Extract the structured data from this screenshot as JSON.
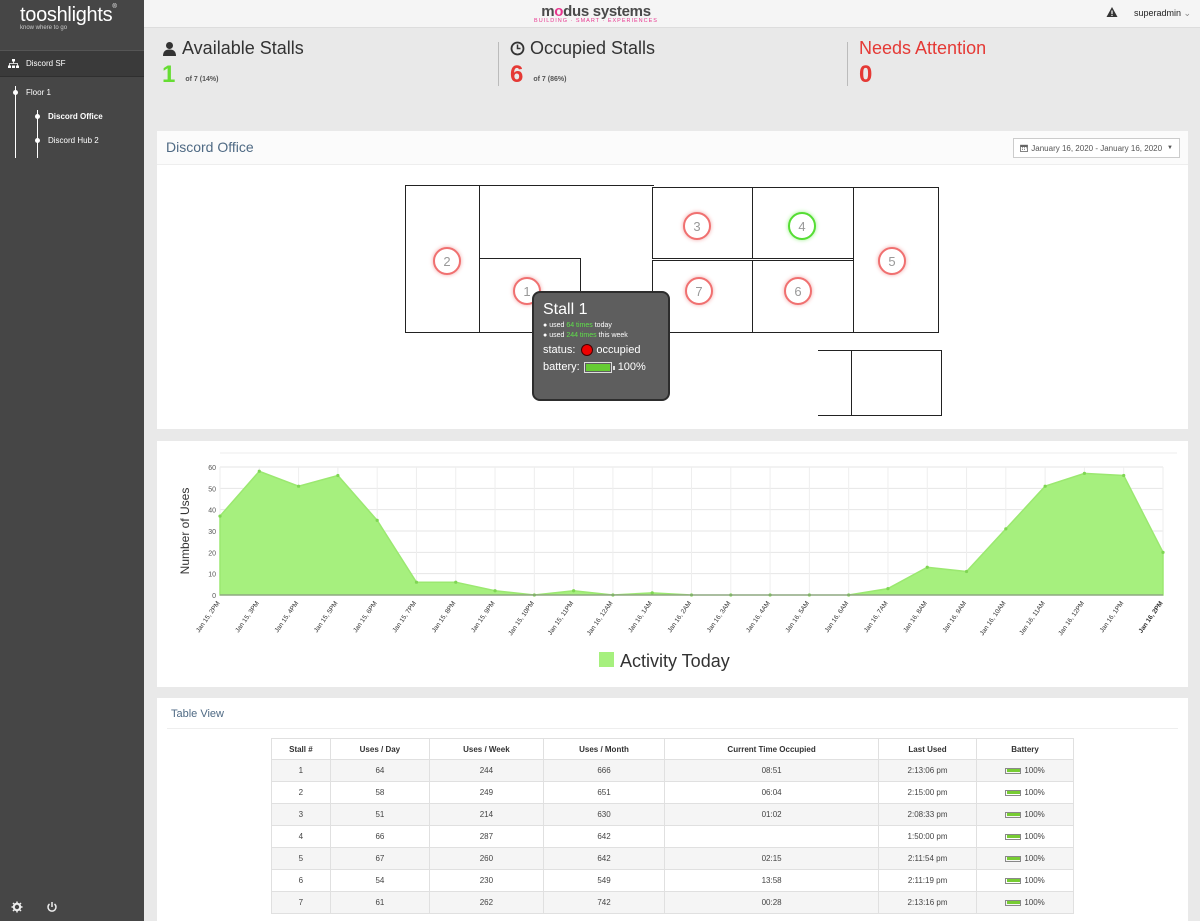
{
  "sidebar": {
    "brand": "tooshlights",
    "tagline": "know where to go",
    "root_item": "Discord SF",
    "tree": {
      "floor": "Floor 1",
      "rooms": [
        "Discord Office",
        "Discord Hub 2"
      ]
    },
    "icons": [
      "sitemap-icon",
      "gear-icon",
      "power-icon"
    ]
  },
  "topbar": {
    "logo_main_a": "m",
    "logo_main_o": "o",
    "logo_main_b": "dus systems",
    "logo_sub": "BUILDING · SMART · EXPERIENCES",
    "user": "superadmin",
    "user_caret": "⌄"
  },
  "stats": {
    "available": {
      "title": "Available Stalls",
      "value": "1",
      "detail": "of 7 (14%)",
      "color": "#66dd33"
    },
    "occupied": {
      "title": "Occupied Stalls",
      "value": "6",
      "detail": "of 7 (86%)",
      "color": "#e53935"
    },
    "attention": {
      "title": "Needs Attention",
      "value": "0",
      "color": "#e53935"
    }
  },
  "office": {
    "title": "Discord Office",
    "date_range": "January 16, 2020 - January 16, 2020",
    "stalls": [
      {
        "id": "2",
        "status": "occupied"
      },
      {
        "id": "1",
        "status": "occupied"
      },
      {
        "id": "3",
        "status": "occupied"
      },
      {
        "id": "4",
        "status": "free"
      },
      {
        "id": "7",
        "status": "occupied"
      },
      {
        "id": "6",
        "status": "occupied"
      },
      {
        "id": "5",
        "status": "occupied"
      }
    ],
    "tooltip": {
      "title": "Stall 1",
      "line1_pre": "used ",
      "line1_hl": "64 times",
      "line1_post": " today",
      "line2_pre": "used ",
      "line2_hl": "244 times",
      "line2_post": " this week",
      "status_label": "status:",
      "status_value": "occupied",
      "battery_label": "battery:",
      "battery_value": "100%",
      "battery_level": 1.0
    }
  },
  "chart_data": {
    "type": "area",
    "ylabel": "Number of Uses",
    "ylim": [
      0,
      60
    ],
    "yticks": [
      0,
      10,
      20,
      30,
      40,
      50,
      60
    ],
    "legend": "Activity Today",
    "legend_position": "bottom",
    "color": "#a6f07e",
    "grid": true,
    "categories": [
      "Jan 15, 2PM",
      "Jan 15, 3PM",
      "Jan 15, 4PM",
      "Jan 15, 5PM",
      "Jan 15, 6PM",
      "Jan 15, 7PM",
      "Jan 15, 8PM",
      "Jan 15, 9PM",
      "Jan 15, 10PM",
      "Jan 15, 11PM",
      "Jan 16, 12AM",
      "Jan 16, 1AM",
      "Jan 16, 2AM",
      "Jan 16, 3AM",
      "Jan 16, 4AM",
      "Jan 16, 5AM",
      "Jan 16, 6AM",
      "Jan 16, 7AM",
      "Jan 16, 8AM",
      "Jan 16, 9AM",
      "Jan 16, 10AM",
      "Jan 16, 11AM",
      "Jan 16, 12PM",
      "Jan 16, 1PM",
      "Jan 16, 2PM"
    ],
    "values": [
      37,
      58,
      51,
      56,
      35,
      6,
      6,
      2,
      0,
      2,
      0,
      1,
      0,
      0,
      0,
      0,
      0,
      3,
      13,
      11,
      31,
      51,
      57,
      56,
      20
    ]
  },
  "table": {
    "title": "Table View",
    "columns": [
      "Stall #",
      "Uses / Day",
      "Uses / Week",
      "Uses / Month",
      "Current Time Occupied",
      "Last Used",
      "Battery"
    ],
    "rows": [
      [
        "1",
        "64",
        "244",
        "666",
        "08:51",
        "2:13:06 pm",
        "100%"
      ],
      [
        "2",
        "58",
        "249",
        "651",
        "06:04",
        "2:15:00 pm",
        "100%"
      ],
      [
        "3",
        "51",
        "214",
        "630",
        "01:02",
        "2:08:33 pm",
        "100%"
      ],
      [
        "4",
        "66",
        "287",
        "642",
        "",
        "1:50:00 pm",
        "100%"
      ],
      [
        "5",
        "67",
        "260",
        "642",
        "02:15",
        "2:11:54 pm",
        "100%"
      ],
      [
        "6",
        "54",
        "230",
        "549",
        "13:58",
        "2:11:19 pm",
        "100%"
      ],
      [
        "7",
        "61",
        "262",
        "742",
        "00:28",
        "2:13:16 pm",
        "100%"
      ]
    ]
  }
}
